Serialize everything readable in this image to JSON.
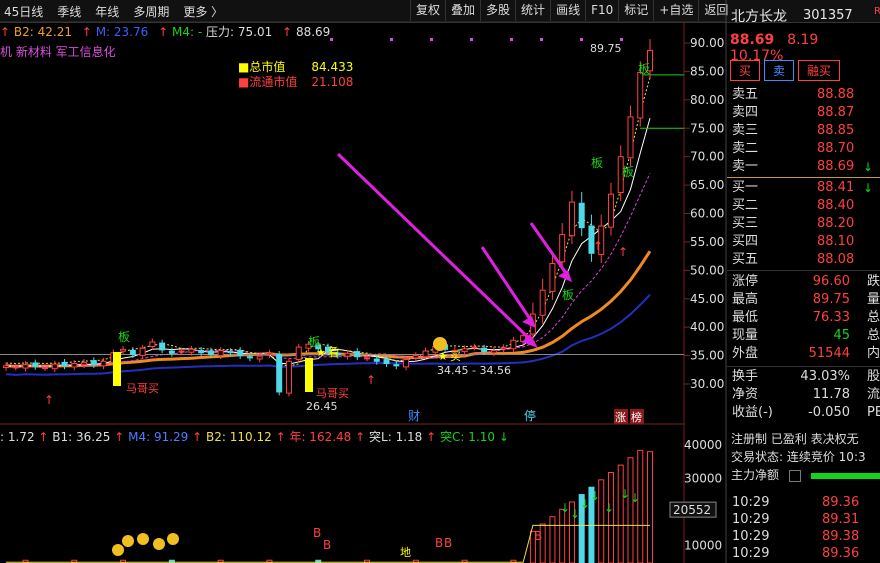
{
  "toolbar": {
    "left": [
      "45日线",
      "季线",
      "年线",
      "多周期",
      "更多 〉"
    ],
    "right": [
      "复权",
      "叠加",
      "多股",
      "统计",
      "画线",
      "F10",
      "标记",
      "+自选",
      "返回"
    ]
  },
  "stock": {
    "name": "北方长龙",
    "code": "301357",
    "badge": "R",
    "price": "88.69",
    "change": "8.19",
    "pct": "10.17%"
  },
  "trade_buttons": [
    "买",
    "卖",
    "融买"
  ],
  "indicator_top": {
    "b2": "B2: 42.21",
    "m": "M: 23.76",
    "m4": "M4: -",
    "pressure": "压力: 75.01",
    "last": "88.69"
  },
  "concepts": "机 新材料 军工信息化",
  "market_cap": {
    "total_label": "总市值",
    "total": "84.433",
    "float_label": "流通市值",
    "float": "21.108"
  },
  "orderbook": {
    "asks": [
      {
        "label": "卖五",
        "price": "88.88"
      },
      {
        "label": "卖四",
        "price": "88.87"
      },
      {
        "label": "卖三",
        "price": "88.85"
      },
      {
        "label": "卖二",
        "price": "88.70"
      },
      {
        "label": "卖一",
        "price": "88.69",
        "arrow": "↓"
      }
    ],
    "bids": [
      {
        "label": "买一",
        "price": "88.41",
        "arrow": "↓"
      },
      {
        "label": "买二",
        "price": "88.40"
      },
      {
        "label": "买三",
        "price": "88.20"
      },
      {
        "label": "买四",
        "price": "88.10"
      },
      {
        "label": "买五",
        "price": "88.08"
      }
    ]
  },
  "stats": [
    {
      "label": "涨停",
      "value": "96.60",
      "color": "#ff4040",
      "tail": "跌"
    },
    {
      "label": "最高",
      "value": "89.75",
      "color": "#ff4040",
      "tail": "量"
    },
    {
      "label": "最低",
      "value": "76.33",
      "color": "#ff4040",
      "tail": "总"
    },
    {
      "label": "现量",
      "value": "45",
      "color": "#17d317",
      "tail": "总"
    },
    {
      "label": "外盘",
      "value": "51544",
      "color": "#ff4040",
      "tail": "内"
    }
  ],
  "stats2": [
    {
      "label": "换手",
      "value": "43.03%",
      "color": "#dddddd",
      "tail": "股"
    },
    {
      "label": "净资",
      "value": "11.78",
      "color": "#dddddd",
      "tail": "流"
    },
    {
      "label": "收益(-)",
      "value": "-0.050",
      "color": "#dddddd",
      "tail": "PE"
    }
  ],
  "info_lines": [
    "注册制 已盈利 表决权无",
    "交易状态: 连续竞价 10:3",
    "主力净额"
  ],
  "ticks": [
    {
      "time": "10:29",
      "price": "89.36"
    },
    {
      "time": "10:29",
      "price": "89.31"
    },
    {
      "time": "10:29",
      "price": "89.38"
    },
    {
      "time": "10:29",
      "price": "89.36"
    }
  ],
  "price_axis": [
    "90.00",
    "85.00",
    "80.00",
    "75.00",
    "70.00",
    "65.00",
    "60.00",
    "55.00",
    "50.00",
    "45.00",
    "40.00",
    "35.00",
    "30.00"
  ],
  "vol_axis": [
    "40000",
    "30000",
    "20552",
    "10000"
  ],
  "legend_bottom": {
    "a": ": 1.72",
    "b1": "B1: 36.25",
    "m": "M4: 91.29",
    "b2": "B2: 110.12",
    "nian": "年: 162.48",
    "tl": "突L: 1.18",
    "tc": "突C: 1.10"
  },
  "annotations": {
    "high": "89.75",
    "low": "26.45",
    "range": "34.45 - 34.56",
    "ban": "板",
    "mage_buy": "马哥买",
    "star_see": "看",
    "star_buy": "买",
    "cai": "财",
    "ting": "停",
    "zhang": "涨",
    "bang": "榜",
    "di": "地",
    "b": "B"
  },
  "chart_data": {
    "type": "candlestick",
    "ylim": [
      30,
      90
    ],
    "closes": [
      33.2,
      33.0,
      33.4,
      33.1,
      32.9,
      33.5,
      33.2,
      33.6,
      33.8,
      33.4,
      34.0,
      35.5,
      36.1,
      35.2,
      36.3,
      37.4,
      36.0,
      35.4,
      35.8,
      36.1,
      35.5,
      35.2,
      35.9,
      35.6,
      35.0,
      34.6,
      34.9,
      35.4,
      28.6,
      34.0,
      36.5,
      37.0,
      36.2,
      35.6,
      35.1,
      35.4,
      34.8,
      34.6,
      34.0,
      33.6,
      33.2,
      34.3,
      35.0,
      35.8,
      36.6,
      36.1,
      35.9,
      36.2,
      36.5,
      35.7,
      35.9,
      36.4,
      37.7,
      38.5,
      42.3,
      46.5,
      51.2,
      56.3,
      62.0,
      57.5,
      53.0,
      57.8,
      63.4,
      70.0,
      77.0,
      84.8,
      88.69
    ],
    "volume_peak": 40000
  }
}
